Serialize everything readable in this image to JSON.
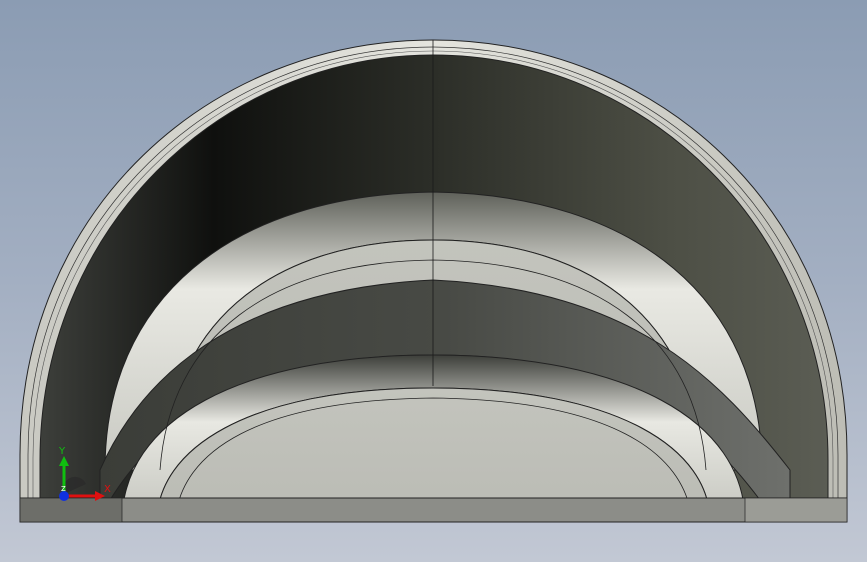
{
  "view": {
    "background_top": "#8b9cb3",
    "background_bottom": "#c2c8d4",
    "model_shape": "half-dome shell with inner ring, cross-section view"
  },
  "triad": {
    "x_label": "X",
    "y_label": "Y",
    "z_label": "Z",
    "x_color": "#e01010",
    "y_color": "#10c010",
    "z_color": "#1030e0"
  }
}
